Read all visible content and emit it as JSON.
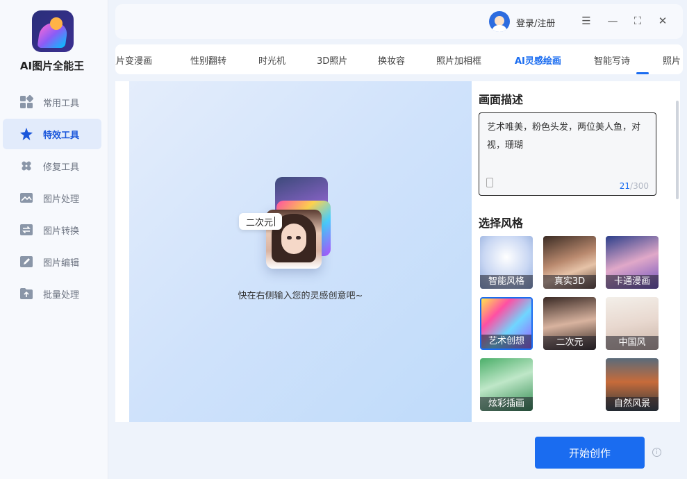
{
  "app": {
    "name": "AI图片全能王"
  },
  "sidebar": {
    "items": [
      {
        "label": "常用工具",
        "icon": "grid-icon"
      },
      {
        "label": "特效工具",
        "icon": "sparkle-icon",
        "active": true
      },
      {
        "label": "修复工具",
        "icon": "bandage-icon"
      },
      {
        "label": "图片处理",
        "icon": "image-icon"
      },
      {
        "label": "图片转换",
        "icon": "convert-icon"
      },
      {
        "label": "图片编辑",
        "icon": "edit-icon"
      },
      {
        "label": "批量处理",
        "icon": "upload-folder-icon"
      }
    ]
  },
  "header": {
    "login_label": "登录/注册",
    "menu_icon": "☰",
    "minimize_icon": "—",
    "fullscreen_icon": "⛶",
    "close_icon": "✕"
  },
  "tabs": [
    {
      "label": "照片变漫画"
    },
    {
      "label": "性别翻转"
    },
    {
      "label": "时光机"
    },
    {
      "label": "3D照片"
    },
    {
      "label": "换妆容"
    },
    {
      "label": "照片加相框"
    },
    {
      "label": "AI灵感绘画",
      "active": true
    },
    {
      "label": "智能写诗"
    },
    {
      "label": "照片"
    }
  ],
  "preview": {
    "bubble_text": "二次元",
    "hint": "快在右侧输入您的灵感创意吧~"
  },
  "description": {
    "title": "画面描述",
    "text": "艺术唯美，粉色头发，两位美人鱼，对视，珊瑚",
    "count": "21",
    "max": "/300"
  },
  "styles": {
    "title": "选择风格",
    "items": [
      {
        "label": "智能风格"
      },
      {
        "label": "真实3D"
      },
      {
        "label": "卡通漫画"
      },
      {
        "label": "艺术创想",
        "selected": true
      },
      {
        "label": "二次元"
      },
      {
        "label": "中国风"
      },
      {
        "label": "炫彩插画"
      },
      {
        "label": "自然风景"
      }
    ]
  },
  "footer": {
    "start_label": "开始创作",
    "info_icon": "i"
  },
  "colors": {
    "accent": "#1a6cf0",
    "sidebar_active_bg": "#e2ebfb"
  }
}
